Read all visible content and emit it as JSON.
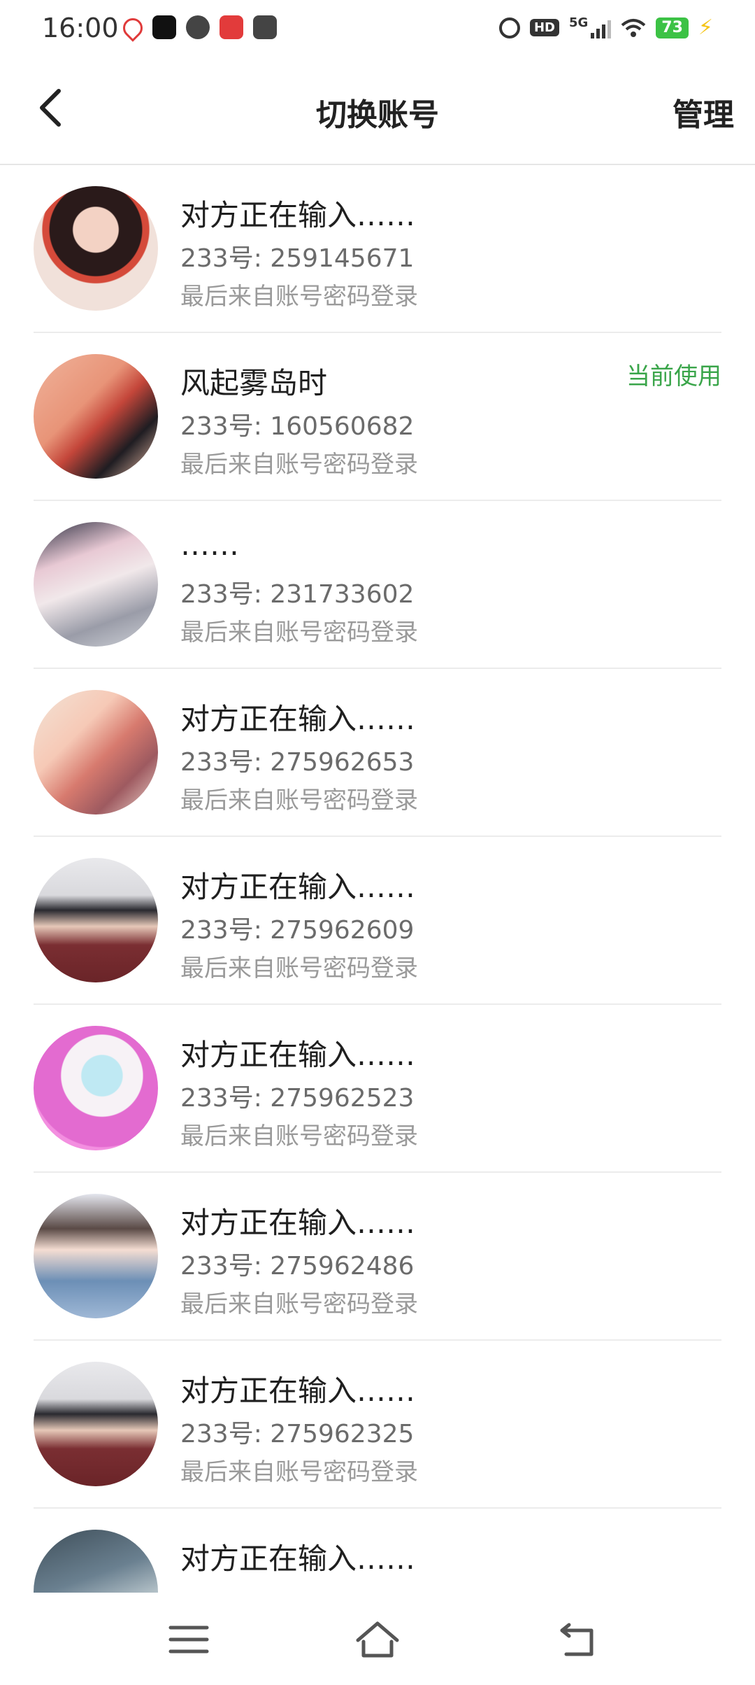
{
  "status_bar": {
    "time": "16:00",
    "hd_label": "HD",
    "network": "5G",
    "battery": "73"
  },
  "header": {
    "title": "切换账号",
    "manage_label": "管理"
  },
  "accounts": [
    {
      "name": "对方正在输入……",
      "uid": "233号: 259145671",
      "login": "最后来自账号密码登录",
      "current": ""
    },
    {
      "name": "风起雾岛时",
      "uid": "233号: 160560682",
      "login": "最后来自账号密码登录",
      "current": "当前使用"
    },
    {
      "name": " ……",
      "uid": "233号: 231733602",
      "login": "最后来自账号密码登录",
      "current": ""
    },
    {
      "name": "对方正在输入……",
      "uid": "233号: 275962653",
      "login": "最后来自账号密码登录",
      "current": ""
    },
    {
      "name": "对方正在输入……",
      "uid": "233号: 275962609",
      "login": "最后来自账号密码登录",
      "current": ""
    },
    {
      "name": "对方正在输入……",
      "uid": "233号: 275962523",
      "login": "最后来自账号密码登录",
      "current": ""
    },
    {
      "name": "对方正在输入……",
      "uid": "233号: 275962486",
      "login": "最后来自账号密码登录",
      "current": ""
    },
    {
      "name": "对方正在输入……",
      "uid": "233号: 275962325",
      "login": "最后来自账号密码登录",
      "current": ""
    },
    {
      "name": "对方正在输入……",
      "uid": "",
      "login": "",
      "current": ""
    }
  ],
  "icons": {
    "back": "chevron-left-icon",
    "menu": "menu-icon",
    "home": "home-icon",
    "return": "return-icon"
  },
  "colors": {
    "accent_green": "#3aa54a",
    "battery_green": "#3cc245"
  }
}
